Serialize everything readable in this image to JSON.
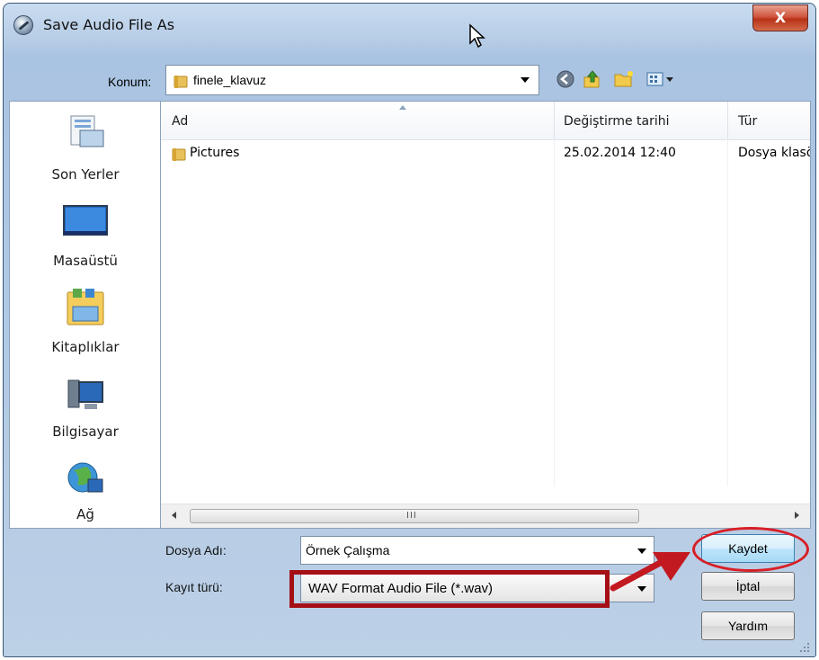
{
  "window": {
    "title": "Save Audio File As",
    "close_glyph": "X"
  },
  "location": {
    "label": "Konum:",
    "value": "finele_klavuz"
  },
  "nav_icons": [
    "back-icon",
    "up-folder-icon",
    "new-folder-icon",
    "view-menu-icon"
  ],
  "places": [
    {
      "label": "Son Yerler",
      "icon": "recent-places-icon"
    },
    {
      "label": "Masaüstü",
      "icon": "desktop-icon"
    },
    {
      "label": "Kitaplıklar",
      "icon": "libraries-icon"
    },
    {
      "label": "Bilgisayar",
      "icon": "computer-icon"
    },
    {
      "label": "Ağ",
      "icon": "network-icon"
    }
  ],
  "columns": {
    "name": "Ad",
    "modified": "Değiştirme tarihi",
    "type": "Tür"
  },
  "rows": [
    {
      "name": "Pictures",
      "modified": "25.02.2014 12:40",
      "type": "Dosya klasörü"
    }
  ],
  "scrollbar": {
    "grip": "III"
  },
  "form": {
    "filename_label": "Dosya Adı:",
    "filename_value": "Örnek Çalışma",
    "filetype_label": "Kayıt türü:",
    "filetype_value": "WAV Format Audio File (*.wav)"
  },
  "buttons": {
    "save": "Kaydet",
    "cancel": "İptal",
    "help": "Yardım"
  },
  "colors": {
    "highlight_box": "#a50f16",
    "highlight_ellipse": "#d81f26",
    "title_gradient": "#b7cde6"
  }
}
